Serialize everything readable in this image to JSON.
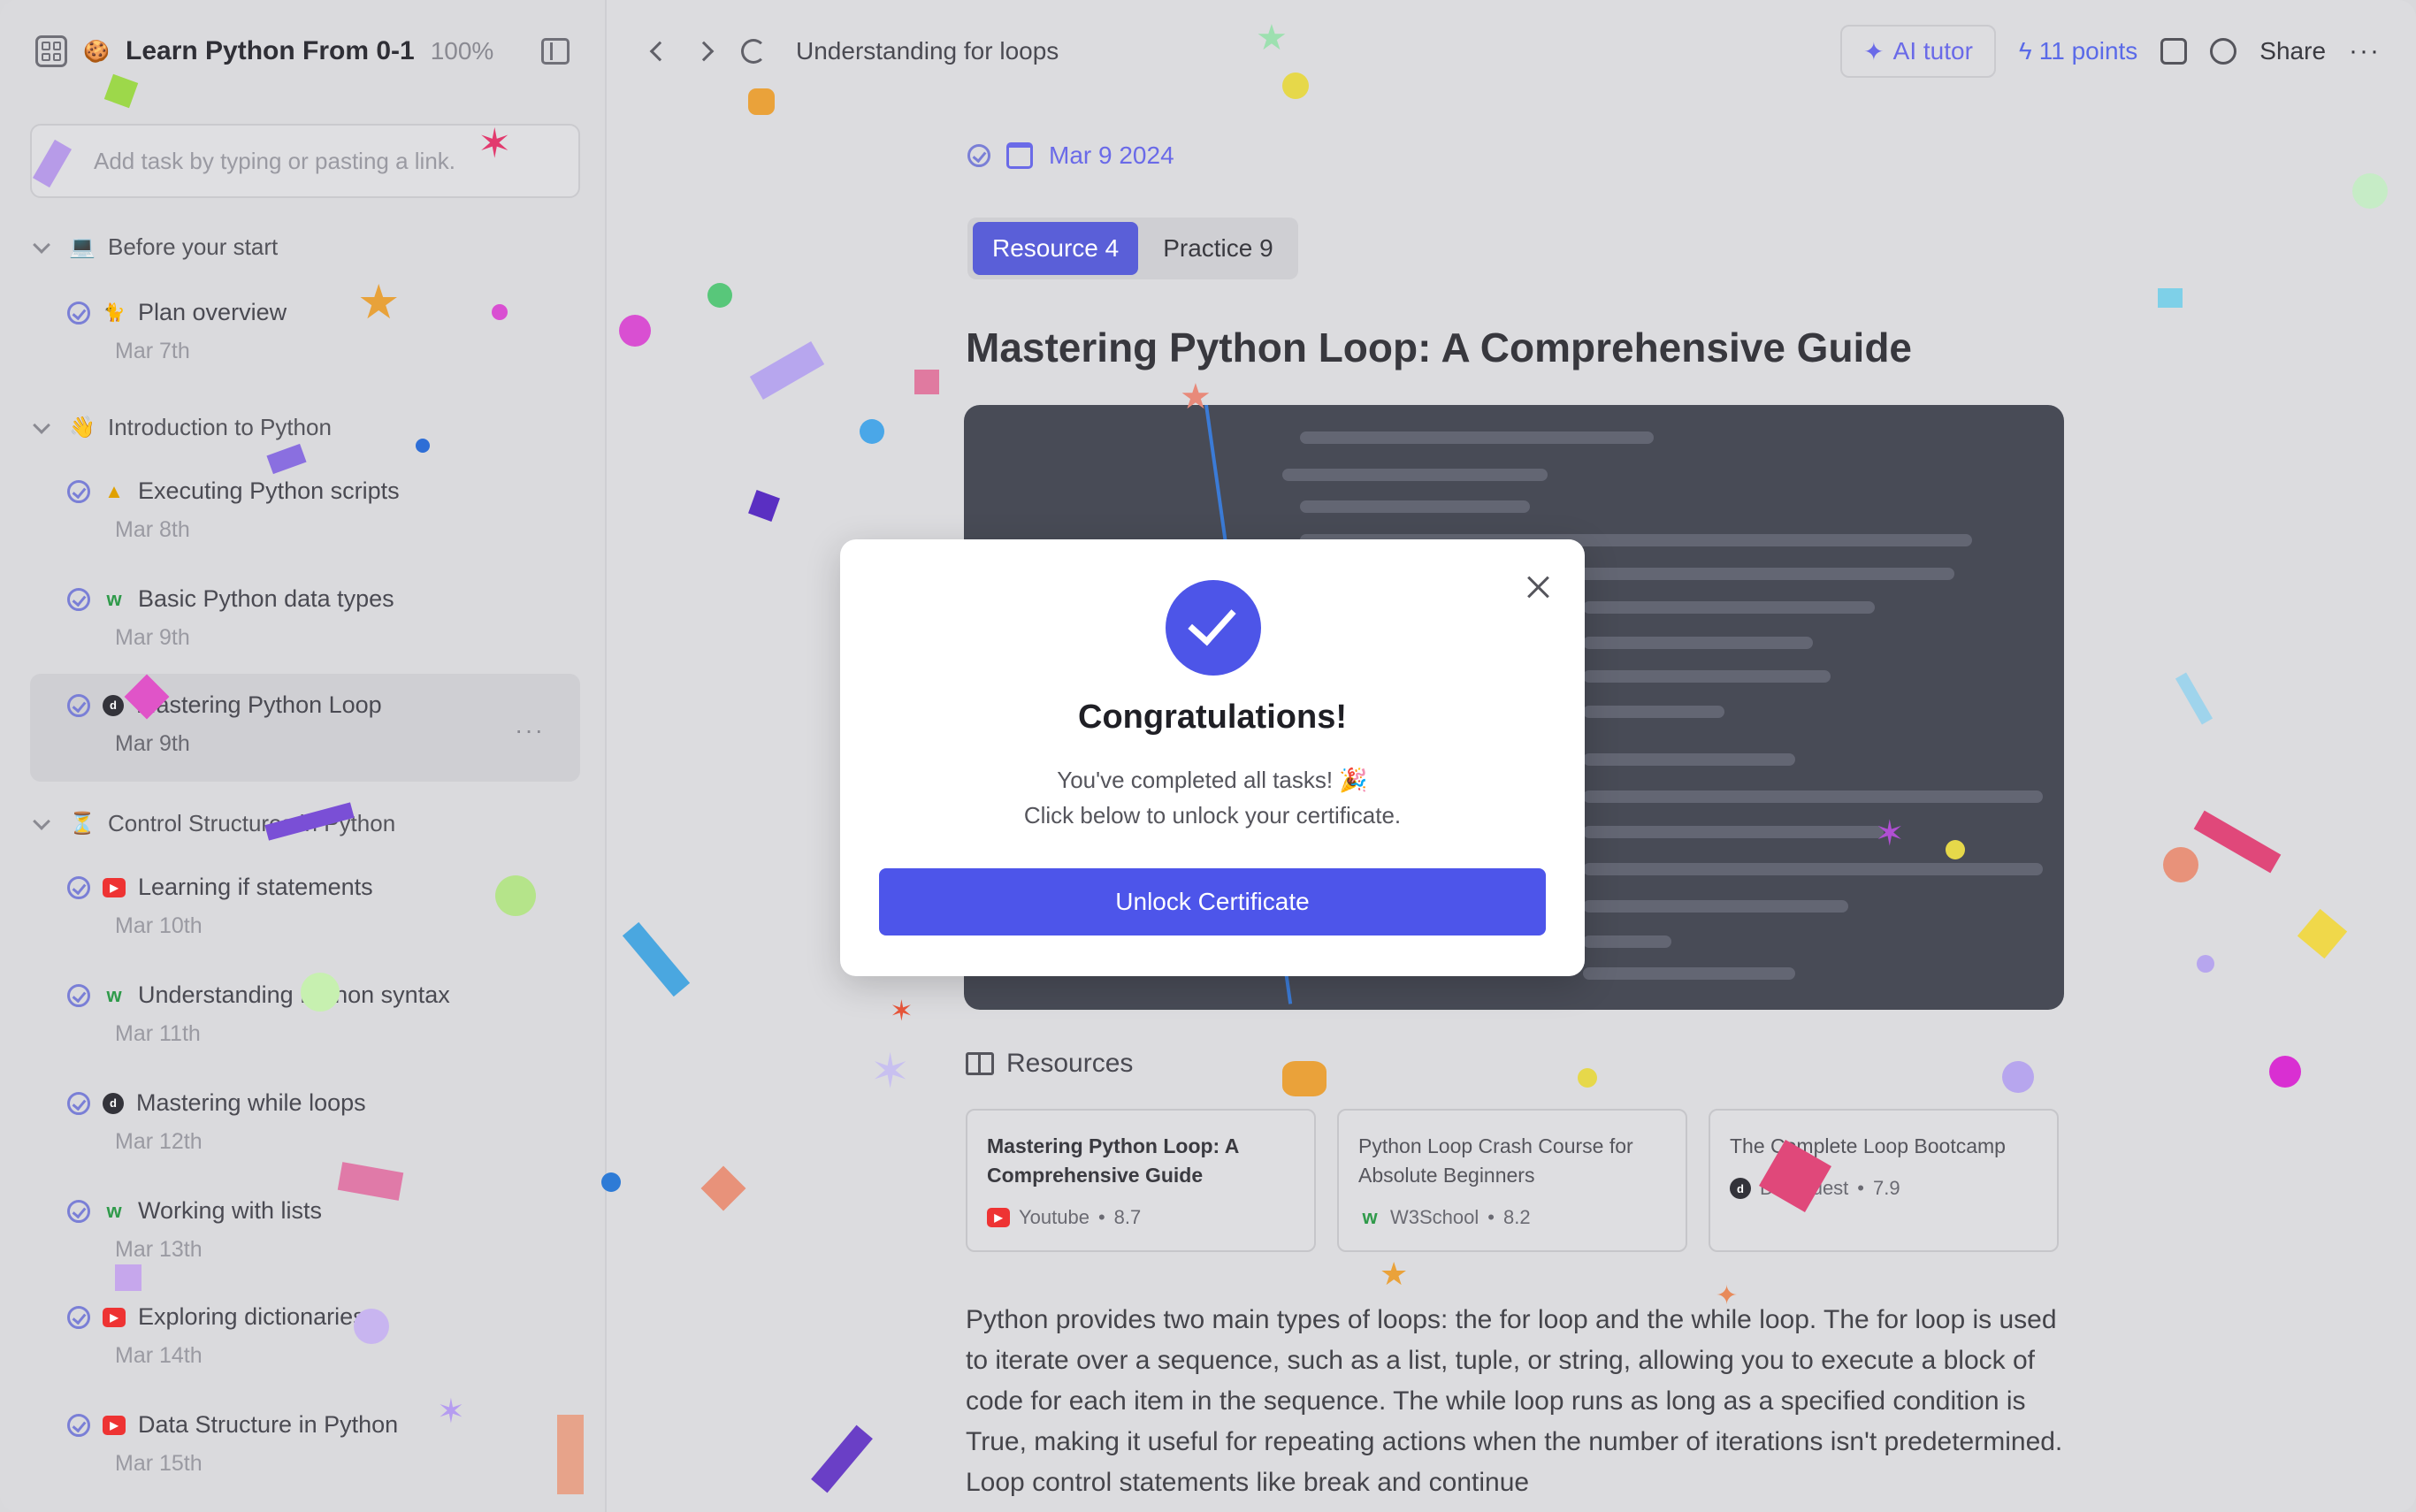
{
  "sidebar": {
    "title": "Learn Python From 0-1",
    "progress": "100%",
    "task_placeholder": "Add task by typing or pasting a link.",
    "sections": [
      {
        "label": "Before your start",
        "emoji": "💻"
      },
      {
        "label": "Introduction to Python",
        "emoji": "👋"
      },
      {
        "label": "Control Structures in Python",
        "emoji": "⏳"
      }
    ],
    "items": [
      {
        "label": "Plan overview",
        "date": "Mar 7th",
        "source": "cat-icon"
      },
      {
        "label": "Executing Python  scripts",
        "date": "Mar 8th",
        "source": "google-drive-icon"
      },
      {
        "label": "Basic Python data types",
        "date": "Mar 9th",
        "source": "w3schools-icon"
      },
      {
        "label": "Mastering Python Loop",
        "date": "Mar 9th",
        "source": "dataquest-icon"
      },
      {
        "label": "Learning if statements",
        "date": "Mar 10th",
        "source": "youtube-icon"
      },
      {
        "label": "Understanding Python syntax",
        "date": "Mar 11th",
        "source": "w3schools-icon"
      },
      {
        "label": "Mastering while loops",
        "date": "Mar 12th",
        "source": "dataquest-icon"
      },
      {
        "label": "Working with lists",
        "date": "Mar 13th",
        "source": "w3schools-icon"
      },
      {
        "label": "Exploring dictionaries",
        "date": "Mar 14th",
        "source": "youtube-icon"
      },
      {
        "label": "Data Structure in Python",
        "date": "Mar 15th",
        "source": "youtube-icon"
      }
    ]
  },
  "header": {
    "breadcrumb": "Understanding for loops",
    "ai_tutor": "AI tutor",
    "points": "11 points",
    "share": "Share"
  },
  "content": {
    "date": "Mar 9 2024",
    "tab_resource": "Resource 4",
    "tab_practice": "Practice 9",
    "title": "Mastering Python Loop: A Comprehensive Guide",
    "resources_label": "Resources",
    "cards": [
      {
        "title": "Mastering Python Loop: A Comprehensive Guide",
        "source": "Youtube",
        "rating": "8.7"
      },
      {
        "title": "Python Loop Crash Course for Absolute Beginners",
        "source": "W3School",
        "rating": "8.2"
      },
      {
        "title": "The Complete Loop Bootcamp",
        "source": "Dataquest",
        "rating": "7.9"
      }
    ],
    "body": "Python provides two main types of loops: the for loop and the while loop. The for loop is used to iterate over a sequence, such as a list, tuple, or string, allowing you to execute a block of code for each item in the sequence. The while loop runs as long as a specified condition is True, making it useful for repeating actions when the number of iterations isn't predetermined. Loop control statements like break and continue"
  },
  "modal": {
    "title": "Congratulations!",
    "line1": "You've completed all tasks! 🎉",
    "line2": "Click below to unlock your certificate.",
    "button": "Unlock Certificate"
  },
  "colors": {
    "accent": "#4d55ea",
    "link": "#6a6ae8"
  }
}
